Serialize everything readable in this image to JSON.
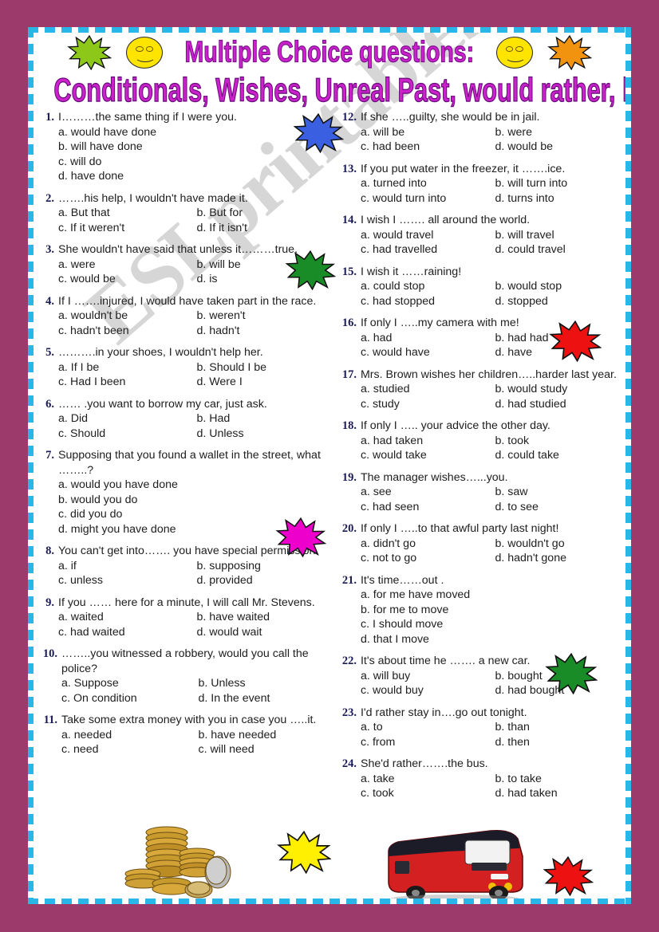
{
  "document": {
    "title_line1": "Multiple Choice questions:",
    "title_line2": "Conditionals, Wishes, Unreal Past, would rather, had better",
    "watermark": "ESLprintables.com"
  },
  "colors": {
    "page_background": "#9b3a6b",
    "sheet": "#ffffff",
    "border_dash": "#29b6e8",
    "title": "#cc22cc",
    "title_outline": "#6a0d7d",
    "number": "#1b1b54",
    "text": "#202020",
    "burst_green_yellow": "#8dc71a",
    "burst_orange": "#f29310",
    "burst_blue": "#3a5fe0",
    "burst_green": "#1a8c27",
    "burst_magenta": "#ee00cc",
    "burst_red": "#ee1111",
    "burst_yellow": "#ffef00",
    "smiley": "#ffe400",
    "bus_body": "#d42020",
    "bus_roof": "#1c1c28"
  },
  "decorations": [
    {
      "name": "burst-green-yellow",
      "color": "#8dc71a"
    },
    {
      "name": "smiley-left",
      "color": "#ffe400"
    },
    {
      "name": "smiley-right",
      "color": "#ffe400"
    },
    {
      "name": "burst-orange",
      "color": "#f29310"
    },
    {
      "name": "burst-blue",
      "color": "#3a5fe0"
    },
    {
      "name": "burst-green",
      "color": "#1a8c27"
    },
    {
      "name": "burst-magenta",
      "color": "#ee00cc"
    },
    {
      "name": "burst-red-top",
      "color": "#ee1111"
    },
    {
      "name": "burst-green-right",
      "color": "#1a8c27"
    },
    {
      "name": "burst-yellow-bottom",
      "color": "#ffef00"
    },
    {
      "name": "burst-red-bottom",
      "color": "#ee1111"
    },
    {
      "name": "coins-image",
      "color": "#c99a2e"
    },
    {
      "name": "bus-image",
      "color": "#d42020"
    }
  ],
  "left_column": [
    {
      "number": "1.",
      "stem": "I………the same thing if I were you.",
      "layout": "one",
      "options": [
        "a. would have done",
        "b. will have done",
        "c. will do",
        "d. have done"
      ]
    },
    {
      "number": "2.",
      "stem": "…….his help, I wouldn't have made it.",
      "layout": "two",
      "options": [
        "a. But that",
        "b. But for",
        "c. If it weren't",
        "d. If it isn't"
      ]
    },
    {
      "number": "3.",
      "stem": "She wouldn't have said that unless it………true.",
      "layout": "two",
      "options": [
        "a. were",
        "b. will be",
        "c. would be",
        "d. is"
      ]
    },
    {
      "number": "4.",
      "stem": "If I …….injured, I would have taken part in the race.",
      "layout": "two",
      "options": [
        "a. wouldn't be",
        "b. weren't",
        "c. hadn't been",
        "d. hadn't"
      ]
    },
    {
      "number": "5.",
      "stem": "……….in your shoes, I wouldn't help her.",
      "layout": "two",
      "options": [
        "a. If I be",
        "b. Should I be",
        "c. Had I been",
        "d. Were I"
      ]
    },
    {
      "number": "6.",
      "stem": "…… .you want to borrow my car, just ask.",
      "layout": "two",
      "options": [
        "a. Did",
        "b. Had",
        "c. Should",
        "d. Unless"
      ]
    },
    {
      "number": "7.",
      "stem": "Supposing that you found a wallet in the street, what ……..?",
      "layout": "one",
      "options": [
        "a. would you have done",
        "b. would you do",
        "c. did you do",
        "d. might you have done"
      ]
    },
    {
      "number": "8.",
      "stem": "You can't get into……. you have special permission.",
      "layout": "two",
      "options": [
        "a. if",
        "b. supposing",
        "c. unless",
        "d. provided"
      ]
    },
    {
      "number": "9.",
      "stem": "If you …… here for a minute, I will call Mr. Stevens.",
      "layout": "two",
      "options": [
        "a. waited",
        "b. have waited",
        "c. had waited",
        "d. would wait"
      ]
    },
    {
      "number": "10.",
      "stem": "……..you witnessed a robbery, would you call the police?",
      "layout": "two",
      "options": [
        "a. Suppose",
        "b. Unless",
        "c. On condition",
        "d. In the event"
      ]
    },
    {
      "number": "11.",
      "stem": "Take some extra money with you in case you …..it.",
      "layout": "two",
      "options": [
        "a. needed",
        "b. have needed",
        "c. need",
        "c. will need"
      ]
    }
  ],
  "right_column": [
    {
      "number": "12.",
      "stem": "If she …..guilty, she would be in jail.",
      "layout": "two",
      "options": [
        "a. will be",
        "b. were",
        "c. had been",
        "d. would be"
      ]
    },
    {
      "number": "13.",
      "stem": "If you put water in the freezer, it …….ice.",
      "layout": "two",
      "options": [
        "a. turned into",
        "b. will turn into",
        "c. would turn into",
        "d. turns into"
      ]
    },
    {
      "number": "14.",
      "stem": "I wish I ……. all around the world.",
      "layout": "two",
      "options": [
        "a. would travel",
        "b. will travel",
        "c. had travelled",
        "d. could travel"
      ]
    },
    {
      "number": "15.",
      "stem": "I wish it ……raining!",
      "layout": "two",
      "options": [
        "a. could stop",
        "b. would stop",
        "c. had stopped",
        "d. stopped"
      ]
    },
    {
      "number": "16.",
      "stem": "If only I …..my camera with me!",
      "layout": "two",
      "options": [
        "a. had",
        "b. had had",
        "c. would have",
        "d. have"
      ]
    },
    {
      "number": "17.",
      "stem": "Mrs. Brown wishes her children…..harder last year.",
      "layout": "two",
      "options": [
        "a. studied",
        "b. would study",
        "c. study",
        "d. had studied"
      ]
    },
    {
      "number": "18.",
      "stem": "If only I ….. your advice the other day.",
      "layout": "two",
      "options": [
        "a. had taken",
        "b. took",
        "c. would take",
        "d. could take"
      ]
    },
    {
      "number": "19.",
      "stem": "The manager wishes…...you.",
      "layout": "two",
      "options": [
        "a. see",
        "b. saw",
        "c. had seen",
        "d. to see"
      ]
    },
    {
      "number": "20.",
      "stem": "If only I …..to that awful party last night!",
      "layout": "two",
      "options": [
        "a. didn't go",
        "b. wouldn't go",
        "c. not to go",
        "d. hadn't gone"
      ]
    },
    {
      "number": "21.",
      "stem": "It's time……out   .",
      "layout": "one",
      "options": [
        "a. for me have moved",
        "b. for me to move",
        "c. I should move",
        "d. that I move"
      ]
    },
    {
      "number": "22.",
      "stem": "It's about time he ……. a new car.",
      "layout": "two",
      "options": [
        "a. will buy",
        "b. bought",
        "c. would buy",
        "d. had bought"
      ]
    },
    {
      "number": "23.",
      "stem": "I'd rather stay in….go out tonight.",
      "layout": "two",
      "options": [
        "a. to",
        "b. than",
        "c. from",
        "d. then"
      ]
    },
    {
      "number": "24.",
      "stem": "She'd rather…….the bus.",
      "layout": "two",
      "options": [
        "a. take",
        "b. to take",
        "c. took",
        "d. had taken"
      ]
    }
  ]
}
